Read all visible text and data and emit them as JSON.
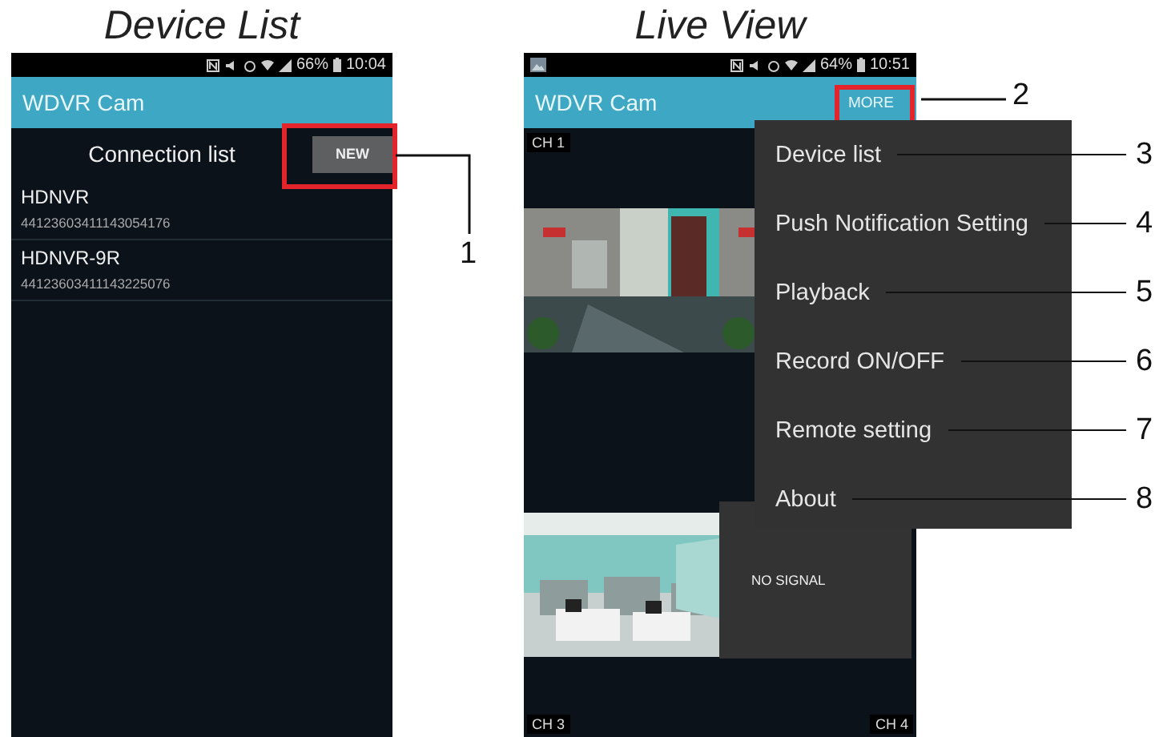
{
  "device_list": {
    "title": "Device List",
    "status_bar": {
      "battery": "66%",
      "time": "10:04"
    },
    "app_title": "WDVR Cam",
    "header": "Connection list",
    "new_button": {
      "label": "NEW",
      "highlighted": true,
      "callout": "1"
    },
    "devices": [
      {
        "name": "HDNVR",
        "id": "44123603411143054176"
      },
      {
        "name": "HDNVR-9R",
        "id": "44123603411143225076"
      }
    ]
  },
  "live_view": {
    "title": "Live View",
    "status_bar": {
      "battery": "64%",
      "time": "10:51"
    },
    "app_title": "WDVR Cam",
    "more_button": {
      "label": "MORE",
      "highlighted": true,
      "callout": "2"
    },
    "tiles": [
      {
        "kind": "picture",
        "label": "CH 1"
      },
      {
        "kind": "picture"
      },
      {
        "kind": "picture",
        "label": "CH 3"
      },
      {
        "kind": "no_signal",
        "label": "CH 4",
        "message": "NO SIGNAL"
      }
    ],
    "menu": [
      {
        "label": "Device list",
        "callout": "3"
      },
      {
        "label": "Push Notification Setting",
        "callout": "4"
      },
      {
        "label": "Playback",
        "callout": "5"
      },
      {
        "label": "Record ON/OFF",
        "callout": "6"
      },
      {
        "label": "Remote setting",
        "callout": "7"
      },
      {
        "label": "About",
        "callout": "8"
      }
    ]
  }
}
